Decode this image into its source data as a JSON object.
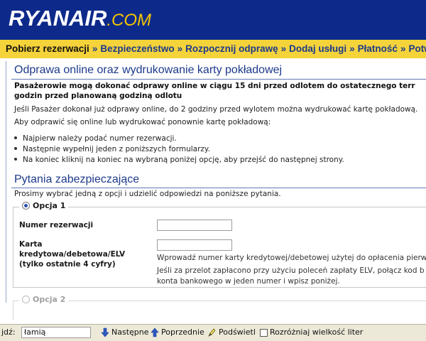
{
  "header": {
    "logo_main": "RYANAIR",
    "logo_suffix": ".COM"
  },
  "breadcrumb": [
    {
      "label": "Pobierz rezerwacji",
      "active": true
    },
    {
      "label": "Bezpieczeństwo",
      "active": false
    },
    {
      "label": "Rozpocznij odprawę",
      "active": false
    },
    {
      "label": "Dodaj usługi",
      "active": false
    },
    {
      "label": "Płatność",
      "active": false
    },
    {
      "label": "Potwierd",
      "active": false
    }
  ],
  "breadcrumb_separator": "»",
  "section1": {
    "title": "Odprawa online oraz wydrukowanie karty pokładowej",
    "intro_line1": "Pasażerowie mogą dokonać odprawy online w ciągu 15 dni przed odlotem do ostatecznego terr",
    "intro_line2": "godzin przed planowaną godziną odlotu",
    "reprint_note": "Jeśli Pasażer dokonał już odprawy online, do 2 godziny przed wylotem można wydrukować kartę pokładową.",
    "how_to": "Aby odprawić się online lub wydrukować ponownie kartę pokładową:",
    "steps": [
      "Najpierw należy podać numer rezerwacji.",
      "Następnie wypełnij jeden z poniższych formularzy.",
      "Na koniec kliknij na koniec na wybraną poniżej opcję, aby przejść do następnej strony."
    ]
  },
  "section2": {
    "title": "Pytania zabezpieczające",
    "instruction": "Prosimy wybrać jedną z opcji i udzielić odpowiedzi na poniższe pytania.",
    "option1": {
      "legend": "Opcja 1",
      "selected": true,
      "booking_label": "Numer rezerwacji",
      "booking_value": "",
      "card_label_l1": "Karta",
      "card_label_l2": "kredytowa/debetowa/ELV",
      "card_label_l3": "(tylko ostatnie 4 cyfry)",
      "card_value": "",
      "card_hint": "Wprowadź numer karty kredytowej/debetowej użytej do opłacenia pierw",
      "elv_hint_l1": "Jeśli za przelot zapłacono przy użyciu poleceń zapłaty ELV, połącz kod b",
      "elv_hint_l2": "konta bankowego w jeden numer i wpisz poniżej."
    },
    "option2": {
      "legend": "Opcja 2",
      "selected": false
    }
  },
  "findbar": {
    "label": "jdź:",
    "query": "łamią",
    "next_label": "Następne",
    "prev_label": "Poprzednie",
    "highlight_label": "Podświetl",
    "match_case_label": "Rozróżniaj wielkość liter",
    "match_case_checked": false
  },
  "colors": {
    "header_bg": "#0d2a8a",
    "crumb_bg": "#f5d33a",
    "title": "#1c3a8a",
    "logo_accent": "#f4c400"
  }
}
